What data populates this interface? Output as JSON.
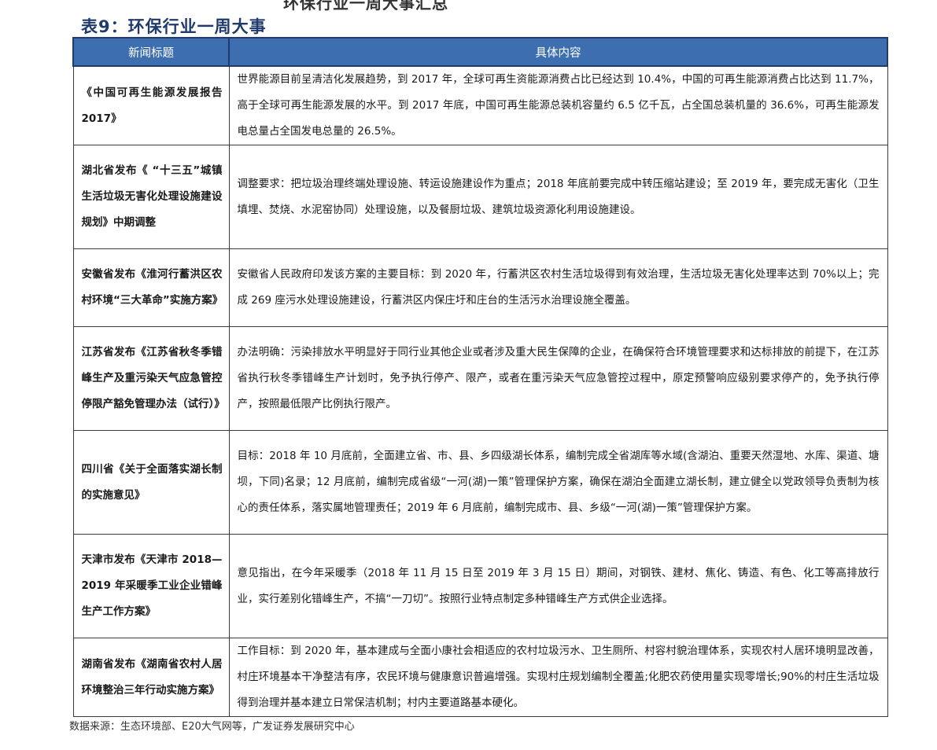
{
  "header_fragment": "环保行业一周大事汇总",
  "table_title": "表9：环保行业一周大事",
  "columns": {
    "title": "新闻标题",
    "content": "具体内容"
  },
  "rows": [
    {
      "title": "《中国可再生能源发展报告 2017》",
      "content": "世界能源目前呈清洁化发展趋势，到 2017 年，全球可再生资能源消费占比已经达到 10.4%，中国的可再生能源消费占比达到 11.7%，高于全球可再生能源发展的水平。到 2017 年底，中国可再生能源总装机容量约 6.5 亿千瓦，占全国总装机量的 36.6%，可再生能源发电总量占全国发电总量的 26.5%。"
    },
    {
      "title": "湖北省发布《 “十三五”城镇生活垃圾无害化处理设施建设规划》中期调整",
      "content": "调整要求：把垃圾治理终端处理设施、转运设施建设作为重点；2018 年底前要完成中转压缩站建设；至 2019 年，要完成无害化（卫生填埋、焚烧、水泥窑协同）处理设施，以及餐厨垃圾、建筑垃圾资源化利用设施建设。"
    },
    {
      "title": "安徽省发布《淮河行蓄洪区农村环境“三大革命”实施方案》",
      "content": "安徽省人民政府印发该方案的主要目标：到 2020 年，行蓄洪区农村生活垃圾得到有效治理，生活垃圾无害化处理率达到 70%以上；完成 269 座污水处理设施建设，行蓄洪区内保庄圩和庄台的生活污水治理设施全覆盖。"
    },
    {
      "title": "江苏省发布《江苏省秋冬季错峰生产及重污染天气应急管控停限产豁免管理办法（试行）》",
      "content": "办法明确：污染排放水平明显好于同行业其他企业或者涉及重大民生保障的企业，在确保符合环境管理要求和达标排放的前提下，在江苏省执行秋冬季错峰生产计划时，免予执行停产、限产，或者在重污染天气应急管控过程中，原定预警响应级别要求停产的，免予执行停产，按照最低限产比例执行限产。"
    },
    {
      "title": "四川省《关于全面落实湖长制的实施意见》",
      "content": "目标：2018 年 10 月底前，全面建立省、市、县、乡四级湖长体系，编制完成全省湖库等水域(含湖泊、重要天然湿地、水库、渠道、塘坝，下同)名录；12 月底前，编制完成省级“一河(湖)一策”管理保护方案，确保在湖泊全面建立湖长制，建立健全以党政领导负责制为核心的责任体系，落实属地管理责任；2019 年 6 月底前，编制完成市、县、乡级“一河(湖)一策”管理保护方案。"
    },
    {
      "title": "天津市发布《天津市 2018—2019 年采暖季工业企业错峰生产工作方案》",
      "content": "意见指出，在今年采暖季（2018 年 11 月 15 日至 2019 年 3 月 15 日）期间，对钢铁、建材、焦化、铸造、有色、化工等高排放行业，实行差别化错峰生产，不搞“一刀切”。按照行业特点制定多种错峰生产方式供企业选择。"
    },
    {
      "title": "湖南省发布《湖南省农村人居环境整治三年行动实施方案》",
      "content": "工作目标：到 2020 年，基本建成与全面小康社会相适应的农村垃圾污水、卫生厕所、村容村貌治理体系，实现农村人居环境明显改善，村庄环境基本干净整洁有序，农民环境与健康意识普遍增强。实现村庄规划编制全覆盖;化肥农药使用量实现零增长;90%的村庄生活垃圾得到治理并基本建立日常保洁机制；村内主要道路基本硬化。"
    }
  ],
  "source_note": "数据来源：生态环境部、E20大气网等，广发证券发展研究中心"
}
